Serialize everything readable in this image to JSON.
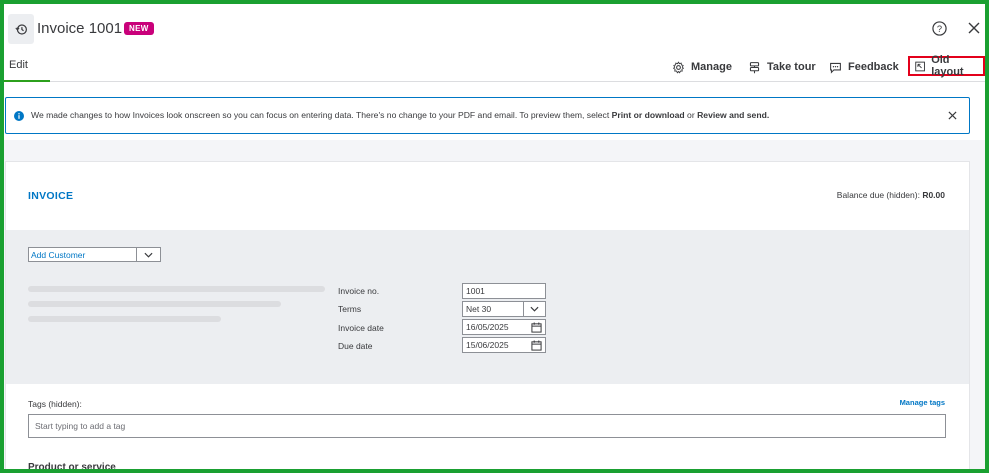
{
  "header": {
    "title": "Invoice 1001",
    "badge": "NEW"
  },
  "tabs": {
    "edit": "Edit"
  },
  "toolbar": {
    "manage": "Manage",
    "take_tour": "Take tour",
    "feedback": "Feedback",
    "old_layout": "Old layout"
  },
  "notice": {
    "text_prefix": "We made changes to how Invoices look onscreen so you can focus on entering data. There's no change to your PDF and email. To preview them, select ",
    "print_download": "Print or download",
    "or": " or ",
    "review_send": "Review and send."
  },
  "invoice": {
    "heading": "INVOICE",
    "balance_label": "Balance due (hidden): ",
    "balance_value": "R0.00",
    "customer_placeholder": "Add Customer",
    "fields": {
      "invoice_no_label": "Invoice no.",
      "invoice_no_value": "1001",
      "terms_label": "Terms",
      "terms_value": "Net 30",
      "invoice_date_label": "Invoice date",
      "invoice_date_value": "16/05/2025",
      "due_date_label": "Due date",
      "due_date_value": "15/06/2025"
    },
    "tags_label": "Tags (hidden):",
    "manage_tags": "Manage tags",
    "tags_placeholder": "Start typing to add a tag",
    "product_label": "Product or service"
  },
  "colors": {
    "brand_green": "#2ca01c",
    "link_blue": "#0077c5",
    "badge_magenta": "#c9007a",
    "highlight_red": "#e3001b",
    "frame_green": "#1aa031"
  }
}
